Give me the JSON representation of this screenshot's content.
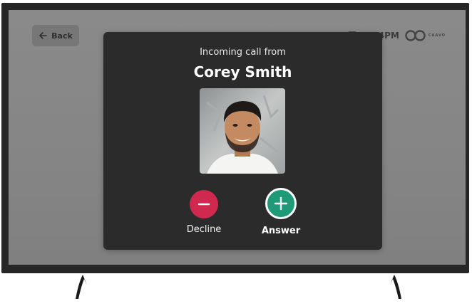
{
  "topbar": {
    "back_label": "Back",
    "time": "1:24PM",
    "brand_name": "CAAVO"
  },
  "call": {
    "subtitle": "Incoming call from",
    "caller_name": "Corey Smith",
    "decline_label": "Decline",
    "answer_label": "Answer"
  },
  "colors": {
    "decline": "#cf2950",
    "answer": "#1e9a78",
    "modal": "#2b2b2b"
  }
}
